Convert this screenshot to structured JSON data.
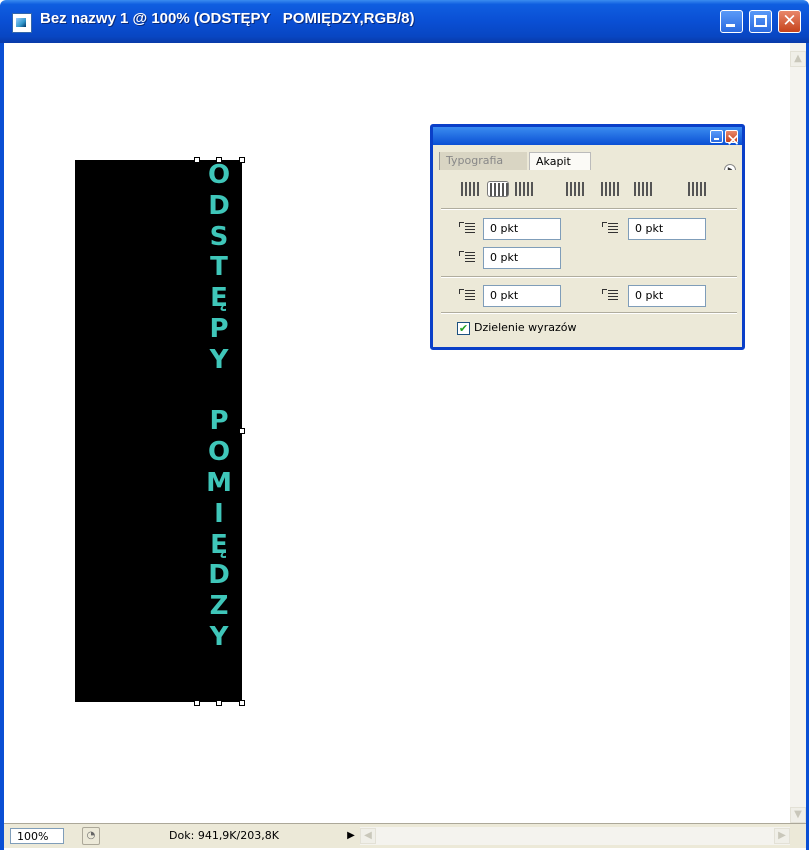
{
  "window": {
    "title": "Bez nazwy 1 @ 100% (ODSTĘPY   POMIĘDZY,RGB/8)",
    "min_icon": "minimize-icon",
    "max_icon": "maximize-icon",
    "close_icon": "close-icon",
    "titlebar_color": "#0a4fd4"
  },
  "canvas": {
    "vertical_text": [
      "O",
      "D",
      "S",
      "T",
      "Ę",
      "P",
      "Y",
      " ",
      "P",
      "O",
      "M",
      "I",
      "Ę",
      "D",
      "Z",
      "Y"
    ],
    "text_color": "#3fc6b9",
    "background_shape_color": "#000000"
  },
  "status": {
    "zoom": "100%",
    "doc_info": "Dok: 941,9K/203,8K",
    "arrow": "▶"
  },
  "panel": {
    "tabs": [
      "Typografia",
      "Akapit"
    ],
    "active_tab": "Akapit",
    "fields": {
      "indent_left": "0 pkt",
      "indent_right": "0 pkt",
      "indent_first": "0 pkt",
      "space_before": "0 pkt",
      "space_after": "0 pkt"
    },
    "hyphenate_label": "Dzielenie wyrazów",
    "hyphenate_checked": "✔"
  }
}
